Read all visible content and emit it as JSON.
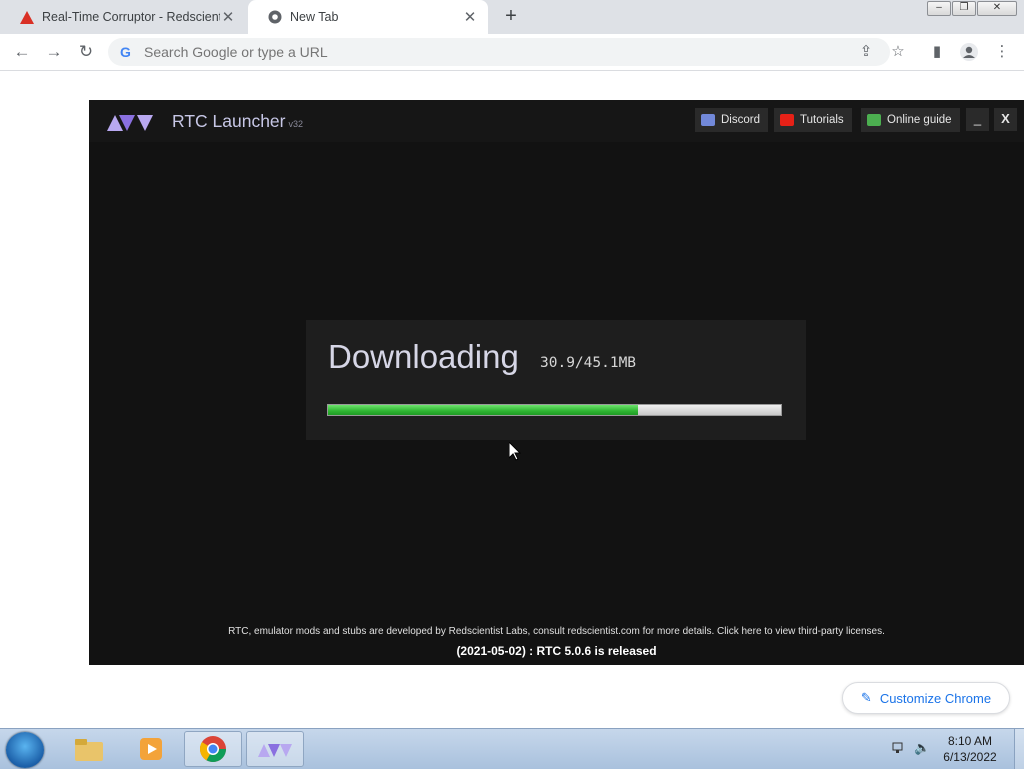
{
  "browser": {
    "tabs": [
      {
        "title": "Real-Time Corruptor - Redscientist Labs",
        "active": false
      },
      {
        "title": "New Tab",
        "active": true
      }
    ],
    "omnibox_placeholder": "Search Google or type a URL",
    "window_controls": {
      "minimize": "–",
      "restore": "❐",
      "close": "✕"
    }
  },
  "rtc": {
    "title": "RTC Launcher",
    "version": "v32",
    "buttons": {
      "discord": "Discord",
      "tutorials": "Tutorials",
      "guide": "Online guide",
      "minimize": "_",
      "close": "X"
    },
    "download": {
      "label": "Downloading",
      "size": "30.9/45.1MB",
      "progress": 0.685
    },
    "footer_notice": "RTC, emulator mods and stubs are developed by Redscientist Labs, consult redscientist.com for more details. Click here to view third-party licenses.",
    "footer_news": "(2021-05-02) : RTC 5.0.6 is released"
  },
  "ntp": {
    "customize_label": "Customize Chrome"
  },
  "taskbar": {
    "time": "8:10 AM",
    "date": "6/13/2022"
  },
  "colors": {
    "progress": "#2fb532",
    "rtc_bg": "#121212",
    "accent_blue": "#1a73e8"
  }
}
